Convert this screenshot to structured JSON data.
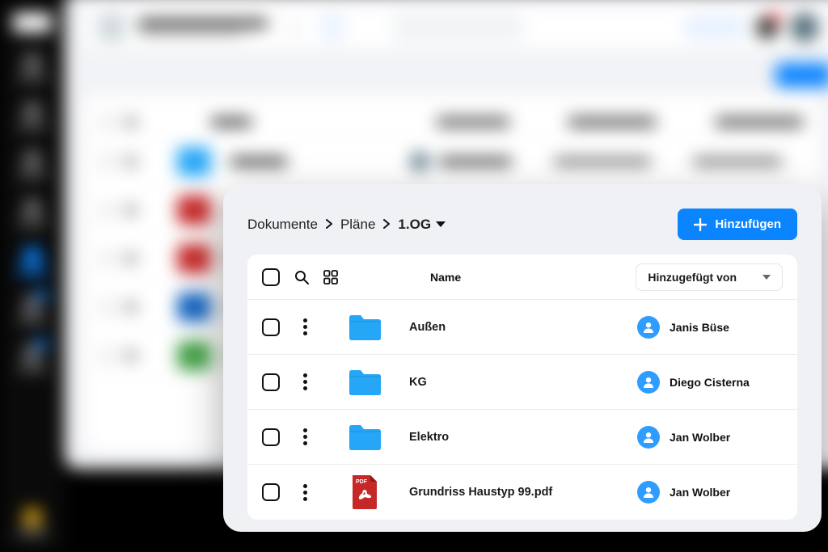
{
  "breadcrumb": {
    "level0": "Dokumente",
    "level1": "Pläne",
    "current": "1.OG"
  },
  "add_button": "Hinzufügen",
  "columns": {
    "name": "Name",
    "added_by": "Hinzugefügt von"
  },
  "rows": [
    {
      "type": "folder",
      "name": "Außen",
      "user": "Janis Büse"
    },
    {
      "type": "folder",
      "name": "KG",
      "user": "Diego Cisterna"
    },
    {
      "type": "folder",
      "name": "Elektro",
      "user": "Jan Wolber"
    },
    {
      "type": "pdf",
      "name": "Grundriss Haustyp 99.pdf",
      "user": "Jan Wolber"
    }
  ],
  "pdf_label": "PDF",
  "colors": {
    "accent": "#0a84ff",
    "folder": "#25a6f6",
    "pdf": "#c62828",
    "avatar": "#2f9cff"
  }
}
